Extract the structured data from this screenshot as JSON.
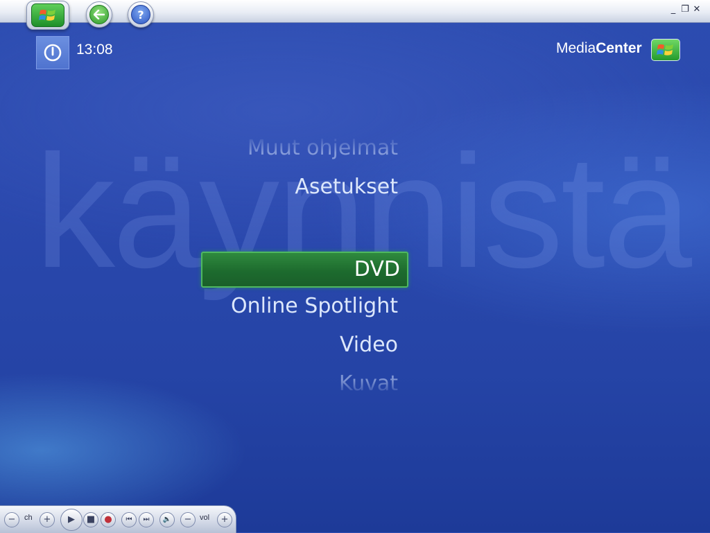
{
  "top_bar": {
    "start_icon": "windows-flag-icon",
    "back_icon": "back-arrow-icon",
    "help_icon": "question-mark-icon",
    "help_glyph": "?",
    "minimize_glyph": "_",
    "restore_glyph": "❐",
    "close_glyph": "✕"
  },
  "header": {
    "power_icon": "power-icon",
    "clock": "13:08",
    "brand_part1": "Media",
    "brand_part2": "Center"
  },
  "background_text": "käynnistä",
  "menu": {
    "items": [
      {
        "label": "Muut ohjelmat",
        "state": "faded"
      },
      {
        "label": "Asetukset",
        "state": "normal"
      },
      {
        "label": "DVD",
        "state": "selected"
      },
      {
        "label": "Online Spotlight",
        "state": "normal"
      },
      {
        "label": "Video",
        "state": "normal"
      },
      {
        "label": "Kuvat",
        "state": "faded"
      }
    ]
  },
  "transport": {
    "ch_label": "ch",
    "vol_label": "vol",
    "minus_glyph": "−",
    "plus_glyph": "+",
    "play_glyph": "▶",
    "stop_glyph": "■",
    "record_glyph": "●",
    "prev_glyph": "⏮",
    "next_glyph": "⏭",
    "mute_glyph": "🔈"
  },
  "colors": {
    "background": "#2a48ad",
    "selected": "#1d6b2e",
    "accent_green": "#4fb860"
  }
}
